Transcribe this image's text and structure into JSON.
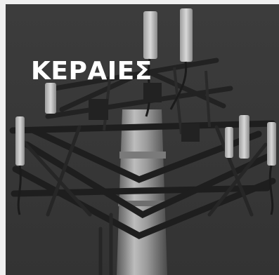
{
  "tile": {
    "title": "ΚΕΡΑΙΕΣ",
    "image_subject": "cell-tower-antennas"
  },
  "colors": {
    "page_background": "#f0f0f0",
    "tile_background": "#393939",
    "title_text": "#ffffff"
  }
}
